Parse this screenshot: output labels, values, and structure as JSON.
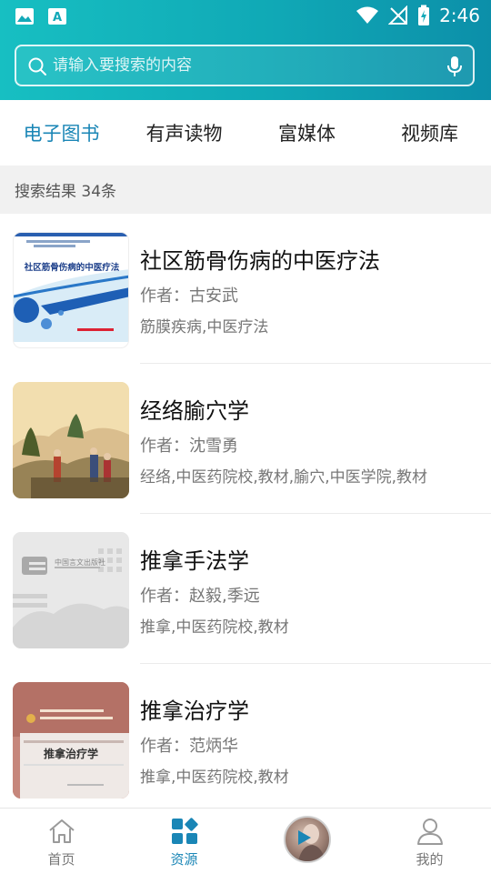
{
  "statusbar": {
    "time": "2:46"
  },
  "search": {
    "placeholder": "请输入要搜索的内容"
  },
  "tabs": [
    {
      "label": "电子图书",
      "active": true
    },
    {
      "label": "有声读物",
      "active": false
    },
    {
      "label": "富媒体",
      "active": false
    },
    {
      "label": "视频库",
      "active": false
    }
  ],
  "results": {
    "count_text": "搜索结果 34条"
  },
  "books": [
    {
      "title": "社区筋骨伤病的中医疗法",
      "author": "作者：古安武",
      "tags": "筋膜疾病,中医疗法",
      "cover_title": "社区筋骨伤病的中医疗法"
    },
    {
      "title": "经络腧穴学",
      "author": "作者：沈雪勇",
      "tags": "经络,中医药院校,教材,腧穴,中医学院,教材"
    },
    {
      "title": "推拿手法学",
      "author": "作者：赵毅,季远",
      "tags": "推拿,中医药院校,教材",
      "cover_publisher": "中国言文出版社"
    },
    {
      "title": "推拿治疗学",
      "author": "作者：范炳华",
      "tags": "推拿,中医药院校,教材",
      "cover_title": "推拿治疗学"
    }
  ],
  "nav": [
    {
      "label": "首页",
      "icon": "home-icon",
      "active": false
    },
    {
      "label": "资源",
      "icon": "resources-grid-icon",
      "active": true
    },
    {
      "label": "",
      "icon": "play-avatar-icon",
      "active": false
    },
    {
      "label": "我的",
      "icon": "profile-icon",
      "active": false
    }
  ],
  "colors": {
    "accent": "#1a86b6",
    "header_start": "#17bfc2",
    "header_end": "#0c8fa9"
  }
}
